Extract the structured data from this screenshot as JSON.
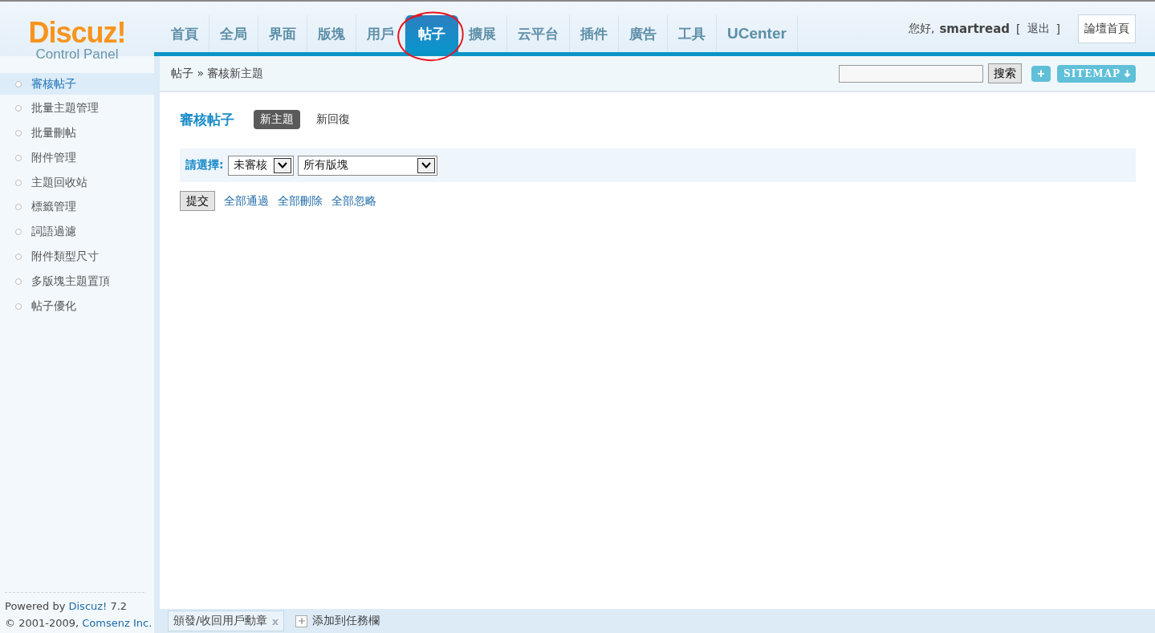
{
  "logo": {
    "title": "Discuz!",
    "subtitle": "Control Panel"
  },
  "nav_tabs": [
    {
      "label": "首頁",
      "selected": false
    },
    {
      "label": "全局",
      "selected": false
    },
    {
      "label": "界面",
      "selected": false
    },
    {
      "label": "版塊",
      "selected": false
    },
    {
      "label": "用戶",
      "selected": false
    },
    {
      "label": "帖子",
      "selected": true
    },
    {
      "label": "擴展",
      "selected": false
    },
    {
      "label": "云平台",
      "selected": false
    },
    {
      "label": "插件",
      "selected": false
    },
    {
      "label": "廣告",
      "selected": false
    },
    {
      "label": "工具",
      "selected": false
    },
    {
      "label": "UCenter",
      "selected": false
    }
  ],
  "user": {
    "greeting": "您好,",
    "name": "smartread",
    "open_bracket": "[",
    "logout": "退出",
    "close_bracket": "]",
    "forum_home": "論壇首頁"
  },
  "breadcrumb": {
    "section": "帖子",
    "separator": "»",
    "page": "審核新主題"
  },
  "search": {
    "button": "搜索"
  },
  "toolbar": {
    "add": "+",
    "sitemap": "SITEMAP"
  },
  "sidebar": {
    "items": [
      {
        "label": "審核帖子",
        "selected": true
      },
      {
        "label": "批量主題管理",
        "selected": false
      },
      {
        "label": "批量刪帖",
        "selected": false
      },
      {
        "label": "附件管理",
        "selected": false
      },
      {
        "label": "主題回收站",
        "selected": false
      },
      {
        "label": "標籤管理",
        "selected": false
      },
      {
        "label": "詞語過濾",
        "selected": false
      },
      {
        "label": "附件類型尺寸",
        "selected": false
      },
      {
        "label": "多版塊主題置頂",
        "selected": false
      },
      {
        "label": "帖子優化",
        "selected": false
      }
    ]
  },
  "footer": [
    {
      "prefix": "Powered by",
      "link": "Discuz!",
      "suffix": "7.2"
    },
    {
      "prefix": "© 2001-2009,",
      "link": "Comsenz Inc."
    }
  ],
  "content": {
    "title": "審核帖子",
    "subtabs": [
      {
        "label": "新主題",
        "selected": true
      },
      {
        "label": "新回復",
        "selected": false
      }
    ],
    "filter_label": "請選擇:",
    "status_select": "未審核",
    "forum_select": "所有版塊",
    "submit": "提交",
    "actions": [
      "全部通過",
      "全部刪除",
      "全部忽略"
    ]
  },
  "taskbar": {
    "task": "頒發/收回用戶勳章",
    "close": "x",
    "add": "添加到任務欄"
  }
}
